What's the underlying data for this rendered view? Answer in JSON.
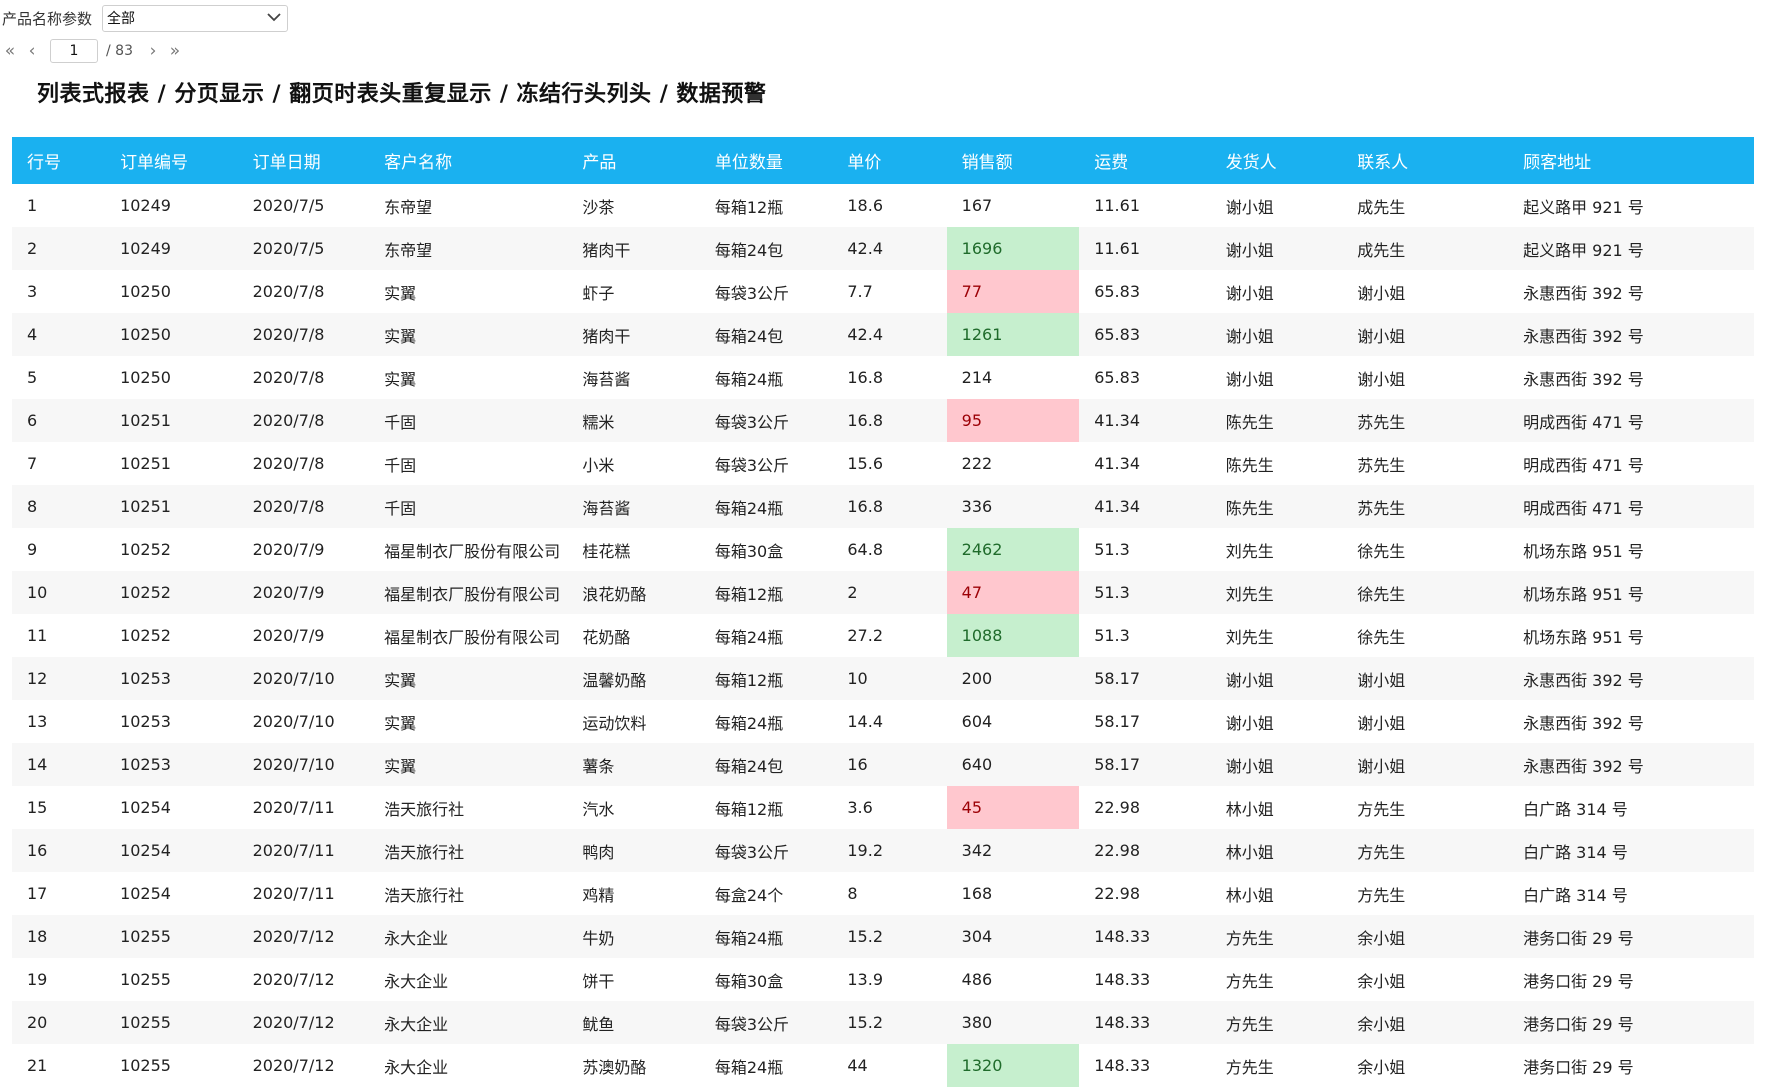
{
  "filter": {
    "label": "产品名称参数",
    "selected": "全部"
  },
  "pager": {
    "current_page": "1",
    "total_label": "/ 83",
    "first_icon": "«",
    "prev_icon": "‹",
    "next_icon": "›",
    "last_icon": "»"
  },
  "title": "列表式报表 / 分页显示 / 翻页时表头重复显示 / 冻结行头列头 / 数据预警",
  "colors": {
    "header_bg": "#1ab1f0",
    "warn_high_bg": "#c6efce",
    "warn_low_bg": "#ffc7ce"
  },
  "table": {
    "columns": [
      "行号",
      "订单编号",
      "订单日期",
      "客户名称",
      "产品",
      "单位数量",
      "单价",
      "销售额",
      "运费",
      "发货人",
      "联系人",
      "顾客地址"
    ],
    "rows": [
      {
        "cells": [
          "1",
          "10249",
          "2020/7/5",
          "东帝望",
          "沙茶",
          "每箱12瓶",
          "18.6",
          "167",
          "11.61",
          "谢小姐",
          "成先生",
          "起义路甲 921 号"
        ],
        "warn": ""
      },
      {
        "cells": [
          "2",
          "10249",
          "2020/7/5",
          "东帝望",
          "猪肉干",
          "每箱24包",
          "42.4",
          "1696",
          "11.61",
          "谢小姐",
          "成先生",
          "起义路甲 921 号"
        ],
        "warn": "high"
      },
      {
        "cells": [
          "3",
          "10250",
          "2020/7/8",
          "实翼",
          "虾子",
          "每袋3公斤",
          "7.7",
          "77",
          "65.83",
          "谢小姐",
          "谢小姐",
          "永惠西街 392 号"
        ],
        "warn": "low"
      },
      {
        "cells": [
          "4",
          "10250",
          "2020/7/8",
          "实翼",
          "猪肉干",
          "每箱24包",
          "42.4",
          "1261",
          "65.83",
          "谢小姐",
          "谢小姐",
          "永惠西街 392 号"
        ],
        "warn": "high"
      },
      {
        "cells": [
          "5",
          "10250",
          "2020/7/8",
          "实翼",
          "海苔酱",
          "每箱24瓶",
          "16.8",
          "214",
          "65.83",
          "谢小姐",
          "谢小姐",
          "永惠西街 392 号"
        ],
        "warn": ""
      },
      {
        "cells": [
          "6",
          "10251",
          "2020/7/8",
          "千固",
          "糯米",
          "每袋3公斤",
          "16.8",
          "95",
          "41.34",
          "陈先生",
          "苏先生",
          "明成西街 471 号"
        ],
        "warn": "low"
      },
      {
        "cells": [
          "7",
          "10251",
          "2020/7/8",
          "千固",
          "小米",
          "每袋3公斤",
          "15.6",
          "222",
          "41.34",
          "陈先生",
          "苏先生",
          "明成西街 471 号"
        ],
        "warn": ""
      },
      {
        "cells": [
          "8",
          "10251",
          "2020/7/8",
          "千固",
          "海苔酱",
          "每箱24瓶",
          "16.8",
          "336",
          "41.34",
          "陈先生",
          "苏先生",
          "明成西街 471 号"
        ],
        "warn": ""
      },
      {
        "cells": [
          "9",
          "10252",
          "2020/7/9",
          "福星制衣厂股份有限公司",
          "桂花糕",
          "每箱30盒",
          "64.8",
          "2462",
          "51.3",
          "刘先生",
          "徐先生",
          "机场东路 951 号"
        ],
        "warn": "high"
      },
      {
        "cells": [
          "10",
          "10252",
          "2020/7/9",
          "福星制衣厂股份有限公司",
          "浪花奶酪",
          "每箱12瓶",
          "2",
          "47",
          "51.3",
          "刘先生",
          "徐先生",
          "机场东路 951 号"
        ],
        "warn": "low"
      },
      {
        "cells": [
          "11",
          "10252",
          "2020/7/9",
          "福星制衣厂股份有限公司",
          "花奶酪",
          "每箱24瓶",
          "27.2",
          "1088",
          "51.3",
          "刘先生",
          "徐先生",
          "机场东路 951 号"
        ],
        "warn": "high"
      },
      {
        "cells": [
          "12",
          "10253",
          "2020/7/10",
          "实翼",
          "温馨奶酪",
          "每箱12瓶",
          "10",
          "200",
          "58.17",
          "谢小姐",
          "谢小姐",
          "永惠西街 392 号"
        ],
        "warn": ""
      },
      {
        "cells": [
          "13",
          "10253",
          "2020/7/10",
          "实翼",
          "运动饮料",
          "每箱24瓶",
          "14.4",
          "604",
          "58.17",
          "谢小姐",
          "谢小姐",
          "永惠西街 392 号"
        ],
        "warn": ""
      },
      {
        "cells": [
          "14",
          "10253",
          "2020/7/10",
          "实翼",
          "薯条",
          "每箱24包",
          "16",
          "640",
          "58.17",
          "谢小姐",
          "谢小姐",
          "永惠西街 392 号"
        ],
        "warn": ""
      },
      {
        "cells": [
          "15",
          "10254",
          "2020/7/11",
          "浩天旅行社",
          "汽水",
          "每箱12瓶",
          "3.6",
          "45",
          "22.98",
          "林小姐",
          "方先生",
          "白广路 314 号"
        ],
        "warn": "low"
      },
      {
        "cells": [
          "16",
          "10254",
          "2020/7/11",
          "浩天旅行社",
          "鸭肉",
          "每袋3公斤",
          "19.2",
          "342",
          "22.98",
          "林小姐",
          "方先生",
          "白广路 314 号"
        ],
        "warn": ""
      },
      {
        "cells": [
          "17",
          "10254",
          "2020/7/11",
          "浩天旅行社",
          "鸡精",
          "每盒24个",
          "8",
          "168",
          "22.98",
          "林小姐",
          "方先生",
          "白广路 314 号"
        ],
        "warn": ""
      },
      {
        "cells": [
          "18",
          "10255",
          "2020/7/12",
          "永大企业",
          "牛奶",
          "每箱24瓶",
          "15.2",
          "304",
          "148.33",
          "方先生",
          "余小姐",
          "港务口街 29 号"
        ],
        "warn": ""
      },
      {
        "cells": [
          "19",
          "10255",
          "2020/7/12",
          "永大企业",
          "饼干",
          "每箱30盒",
          "13.9",
          "486",
          "148.33",
          "方先生",
          "余小姐",
          "港务口街 29 号"
        ],
        "warn": ""
      },
      {
        "cells": [
          "20",
          "10255",
          "2020/7/12",
          "永大企业",
          "鱿鱼",
          "每袋3公斤",
          "15.2",
          "380",
          "148.33",
          "方先生",
          "余小姐",
          "港务口街 29 号"
        ],
        "warn": ""
      },
      {
        "cells": [
          "21",
          "10255",
          "2020/7/12",
          "永大企业",
          "苏澳奶酪",
          "每箱24瓶",
          "44",
          "1320",
          "148.33",
          "方先生",
          "余小姐",
          "港务口街 29 号"
        ],
        "warn": "high"
      }
    ]
  }
}
